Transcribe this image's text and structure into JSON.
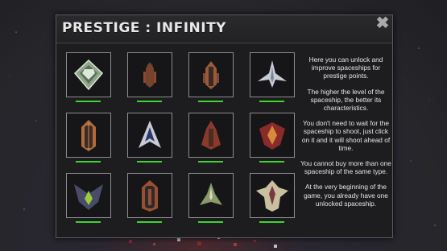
{
  "window": {
    "title": "PRESTIGE : INFINITY",
    "close_icon": "close-icon"
  },
  "ships": [
    {
      "name": "ship-1",
      "color": "#9fb59a",
      "accent": "#dce8d8",
      "level": 1.0
    },
    {
      "name": "ship-2",
      "color": "#8a4a30",
      "accent": "#2c2c2c",
      "level": 1.0
    },
    {
      "name": "ship-3",
      "color": "#9a5a3a",
      "accent": "#3a2a24",
      "level": 1.0
    },
    {
      "name": "ship-4",
      "color": "#c8ccd6",
      "accent": "#7d8596",
      "level": 1.0
    },
    {
      "name": "ship-5",
      "color": "#b36a3a",
      "accent": "#3a2b25",
      "level": 1.0
    },
    {
      "name": "ship-6",
      "color": "#c9ccd8",
      "accent": "#2a3a6a",
      "level": 1.0
    },
    {
      "name": "ship-7",
      "color": "#8a3a2a",
      "accent": "#4a2c24",
      "level": 1.0
    },
    {
      "name": "ship-8",
      "color": "#8b2a2a",
      "accent": "#d88a3a",
      "level": 1.0
    },
    {
      "name": "ship-9",
      "color": "#4a4a6a",
      "accent": "#9acb3a",
      "level": 1.0
    },
    {
      "name": "ship-10",
      "color": "#9a5030",
      "accent": "#2c2a2a",
      "level": 1.0
    },
    {
      "name": "ship-11",
      "color": "#8a9a6a",
      "accent": "#d8d8c0",
      "level": 1.0
    },
    {
      "name": "ship-12",
      "color": "#c8c0a0",
      "accent": "#7a3a3a",
      "level": 1.0
    }
  ],
  "info": {
    "p1": "Here you can unlock and improve spaceships for prestige points.",
    "p2": "The higher the level of the spaceship, the better its characteristics.",
    "p3": "You don't need to wait for the spaceship to shoot, just click on it and it will shoot ahead of time.",
    "p4": "You cannot buy more than one spaceship of the same type.",
    "p5": "At the very beginning of the game, you already have one unlocked spaceship."
  },
  "colors": {
    "level_bar": "#3ad62a",
    "panel_bg": "#1d1d1f",
    "card_border": "#8c8c8f"
  }
}
